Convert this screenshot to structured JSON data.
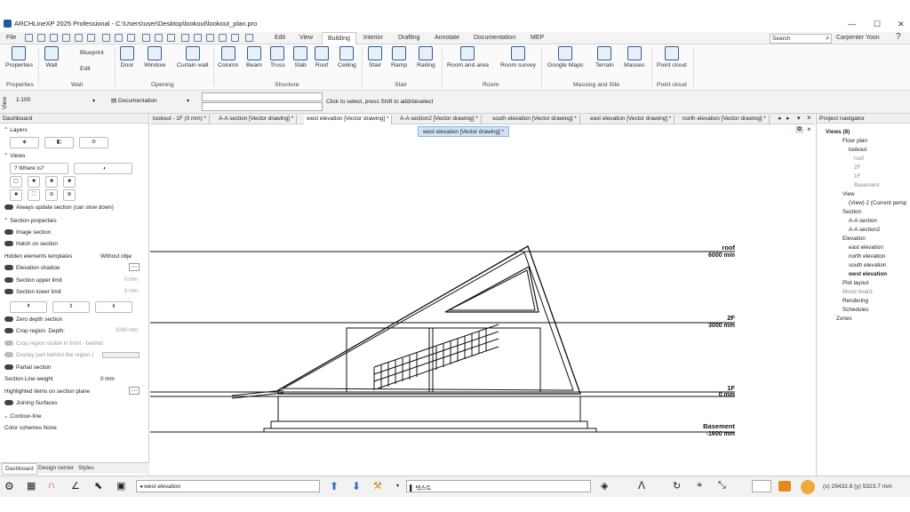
{
  "window": {
    "title": "ARCHLineXP 2025 Professional - C:\\Users\\user\\Desktop\\lookout\\lookout_plan.pro",
    "minimize": "—",
    "maximize": "☐",
    "close": "✕"
  },
  "menu": {
    "file": "File",
    "edit": "Edit",
    "view": "View",
    "tabs": [
      "Building",
      "Interior",
      "Drafting",
      "Annotate",
      "Documentation",
      "MEP"
    ],
    "active_tab": "Building",
    "search_placeholder": "Search",
    "user": "Carpenter Yoon",
    "help": "?"
  },
  "ribbon": {
    "items": [
      "Properties",
      "Wall",
      "Blueprint",
      "Edit",
      "Door",
      "Window",
      "Curtain wall",
      "Column",
      "Beam",
      "Truss",
      "Slab",
      "Roof",
      "Ceiling",
      "Stair",
      "Ramp",
      "Railing",
      "Room and area",
      "Room survey",
      "Google Maps",
      "Terrain",
      "Masses",
      "Point cloud"
    ],
    "groups": [
      "Properties",
      "Wall",
      "Opening",
      "Structure",
      "Stair",
      "Room",
      "Massing and Site",
      "Point cloud"
    ]
  },
  "toolbar": {
    "view_label": "View",
    "scale": "1:100",
    "layer": "Documentation",
    "hint": "Click to select, press Shift to add/deselect"
  },
  "dashboard": {
    "title": "Dashboard",
    "layers": "Layers",
    "views": "Views",
    "where_is": "Where is?",
    "always_update": "Always update section (can slow down)",
    "section_properties": "Section properties",
    "image_section": "Image section",
    "hatch_on_section": "Hatch on section",
    "hidden_templates": "Hidden elements templates",
    "hidden_value": "Without obje",
    "elevation_shadow": "Elevation shadow",
    "upper_limit": "Section upper limit",
    "upper_val": "0 mm",
    "lower_limit": "Section lower limit",
    "lower_val": "0 mm",
    "zero_depth": "Zero depth section",
    "crop_depth": "Crop region. Depth:",
    "crop_depth_val": "1000 mm",
    "crop_visible": "Crop region visible in front - behind",
    "display_part": "Display part behind the region (",
    "partial": "Partial section",
    "line_weight": "Section Line weight",
    "line_weight_val": "0 mm",
    "highlighted": "Highlighted items on section plane",
    "joining": "Joining Surfaces",
    "contour": "Contour-line",
    "color_schemes": "Color schemes",
    "color_schemes_val": "None",
    "tabs": [
      "Dashboard",
      "Design center",
      "Styles"
    ]
  },
  "doc_tabs": [
    "lookout - 1F (0 mm) *",
    "A-A section [Vector drawing] *",
    "west elevation [Vector drawing] *",
    "A-A section2 [Vector drawing] *",
    "south elevation [Vector drawing] *",
    "east elevation [Vector drawing] *",
    "north elevation [Vector drawing] *"
  ],
  "floating_tab": "west elevation [Vector drawing] *",
  "drawing": {
    "levels": [
      {
        "name": "roof",
        "value": "6000 mm"
      },
      {
        "name": "2F",
        "value": "3000 mm"
      },
      {
        "name": "1F",
        "value": "0 mm"
      },
      {
        "name": "Basement",
        "value": "-1600 mm"
      }
    ]
  },
  "navigator": {
    "title": "Project navigator",
    "items": [
      {
        "label": "Views (8)",
        "style": "bold"
      },
      {
        "label": "Floor plan",
        "style": ""
      },
      {
        "label": "lookout",
        "style": ""
      },
      {
        "label": "roof",
        "style": "dim"
      },
      {
        "label": "2F",
        "style": "dim"
      },
      {
        "label": "1F",
        "style": "dim"
      },
      {
        "label": "Basement",
        "style": "dim"
      },
      {
        "label": "View",
        "style": ""
      },
      {
        "label": "(View) 2 (Current persp",
        "style": ""
      },
      {
        "label": "Section",
        "style": ""
      },
      {
        "label": "A-A section",
        "style": ""
      },
      {
        "label": "A-A section2",
        "style": ""
      },
      {
        "label": "Elevation",
        "style": ""
      },
      {
        "label": "east elevation",
        "style": ""
      },
      {
        "label": "north elevation",
        "style": ""
      },
      {
        "label": "south elevation",
        "style": ""
      },
      {
        "label": "west elevation",
        "style": "bold"
      },
      {
        "label": "Plot layout",
        "style": ""
      },
      {
        "label": "Mood board",
        "style": "dim"
      },
      {
        "label": "Rendering",
        "style": ""
      },
      {
        "label": "Schedules",
        "style": ""
      },
      {
        "label": "Zones",
        "style": ""
      }
    ]
  },
  "statusbar": {
    "view_name": "west elevation",
    "korean_text": "텍스트",
    "coords": "(x) 29432.8   (y) 5323.7 mm"
  }
}
